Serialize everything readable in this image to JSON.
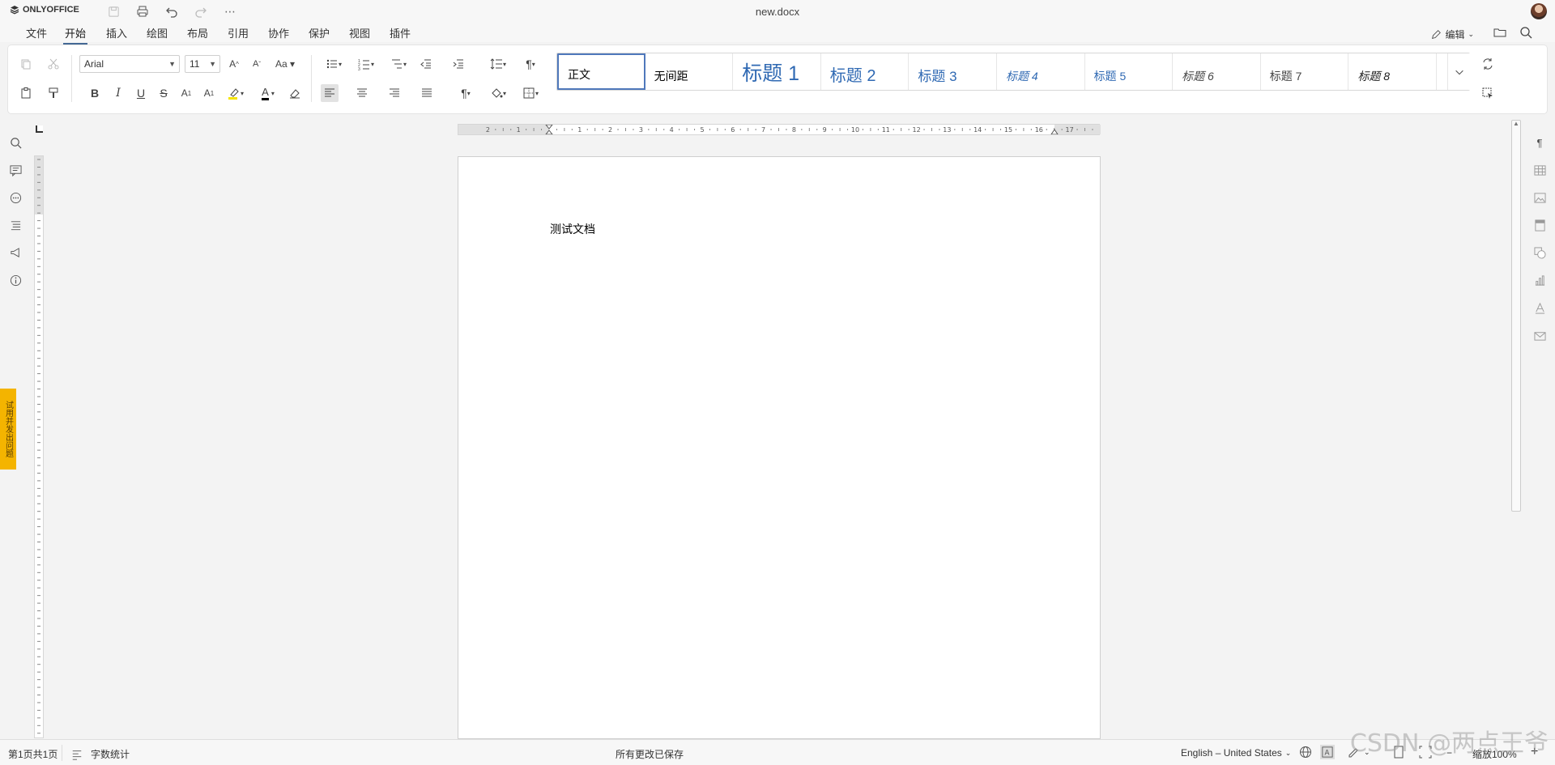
{
  "app": {
    "brand": "ONLYOFFICE",
    "doc_title": "new.docx"
  },
  "menu": {
    "tabs": [
      "文件",
      "开始",
      "插入",
      "绘图",
      "布局",
      "引用",
      "协作",
      "保护",
      "视图",
      "插件"
    ],
    "active_tab": "开始",
    "edit_mode_label": "编辑"
  },
  "toolbar": {
    "font_name": "Arial",
    "font_size": "11",
    "styles": [
      "正文",
      "无间距",
      "标题 1",
      "标题 2",
      "标题 3",
      "标题 4",
      "标题 5",
      "标题 6",
      "标题 7",
      "标题 8"
    ],
    "active_style": "正文"
  },
  "page": {
    "text": "测试文档"
  },
  "feedback": {
    "label": "试用并发出问题"
  },
  "status": {
    "page_info": "第1页共1页",
    "word_count_label": "字数统计",
    "save_status": "所有更改已保存",
    "language": "English – United States",
    "zoom": "缩放100%"
  },
  "watermark": "CSDN @两点王爷",
  "colors": {
    "accent": "#446995",
    "heading_blue": "#2f69b3",
    "feedback_yellow": "#f4b400"
  }
}
